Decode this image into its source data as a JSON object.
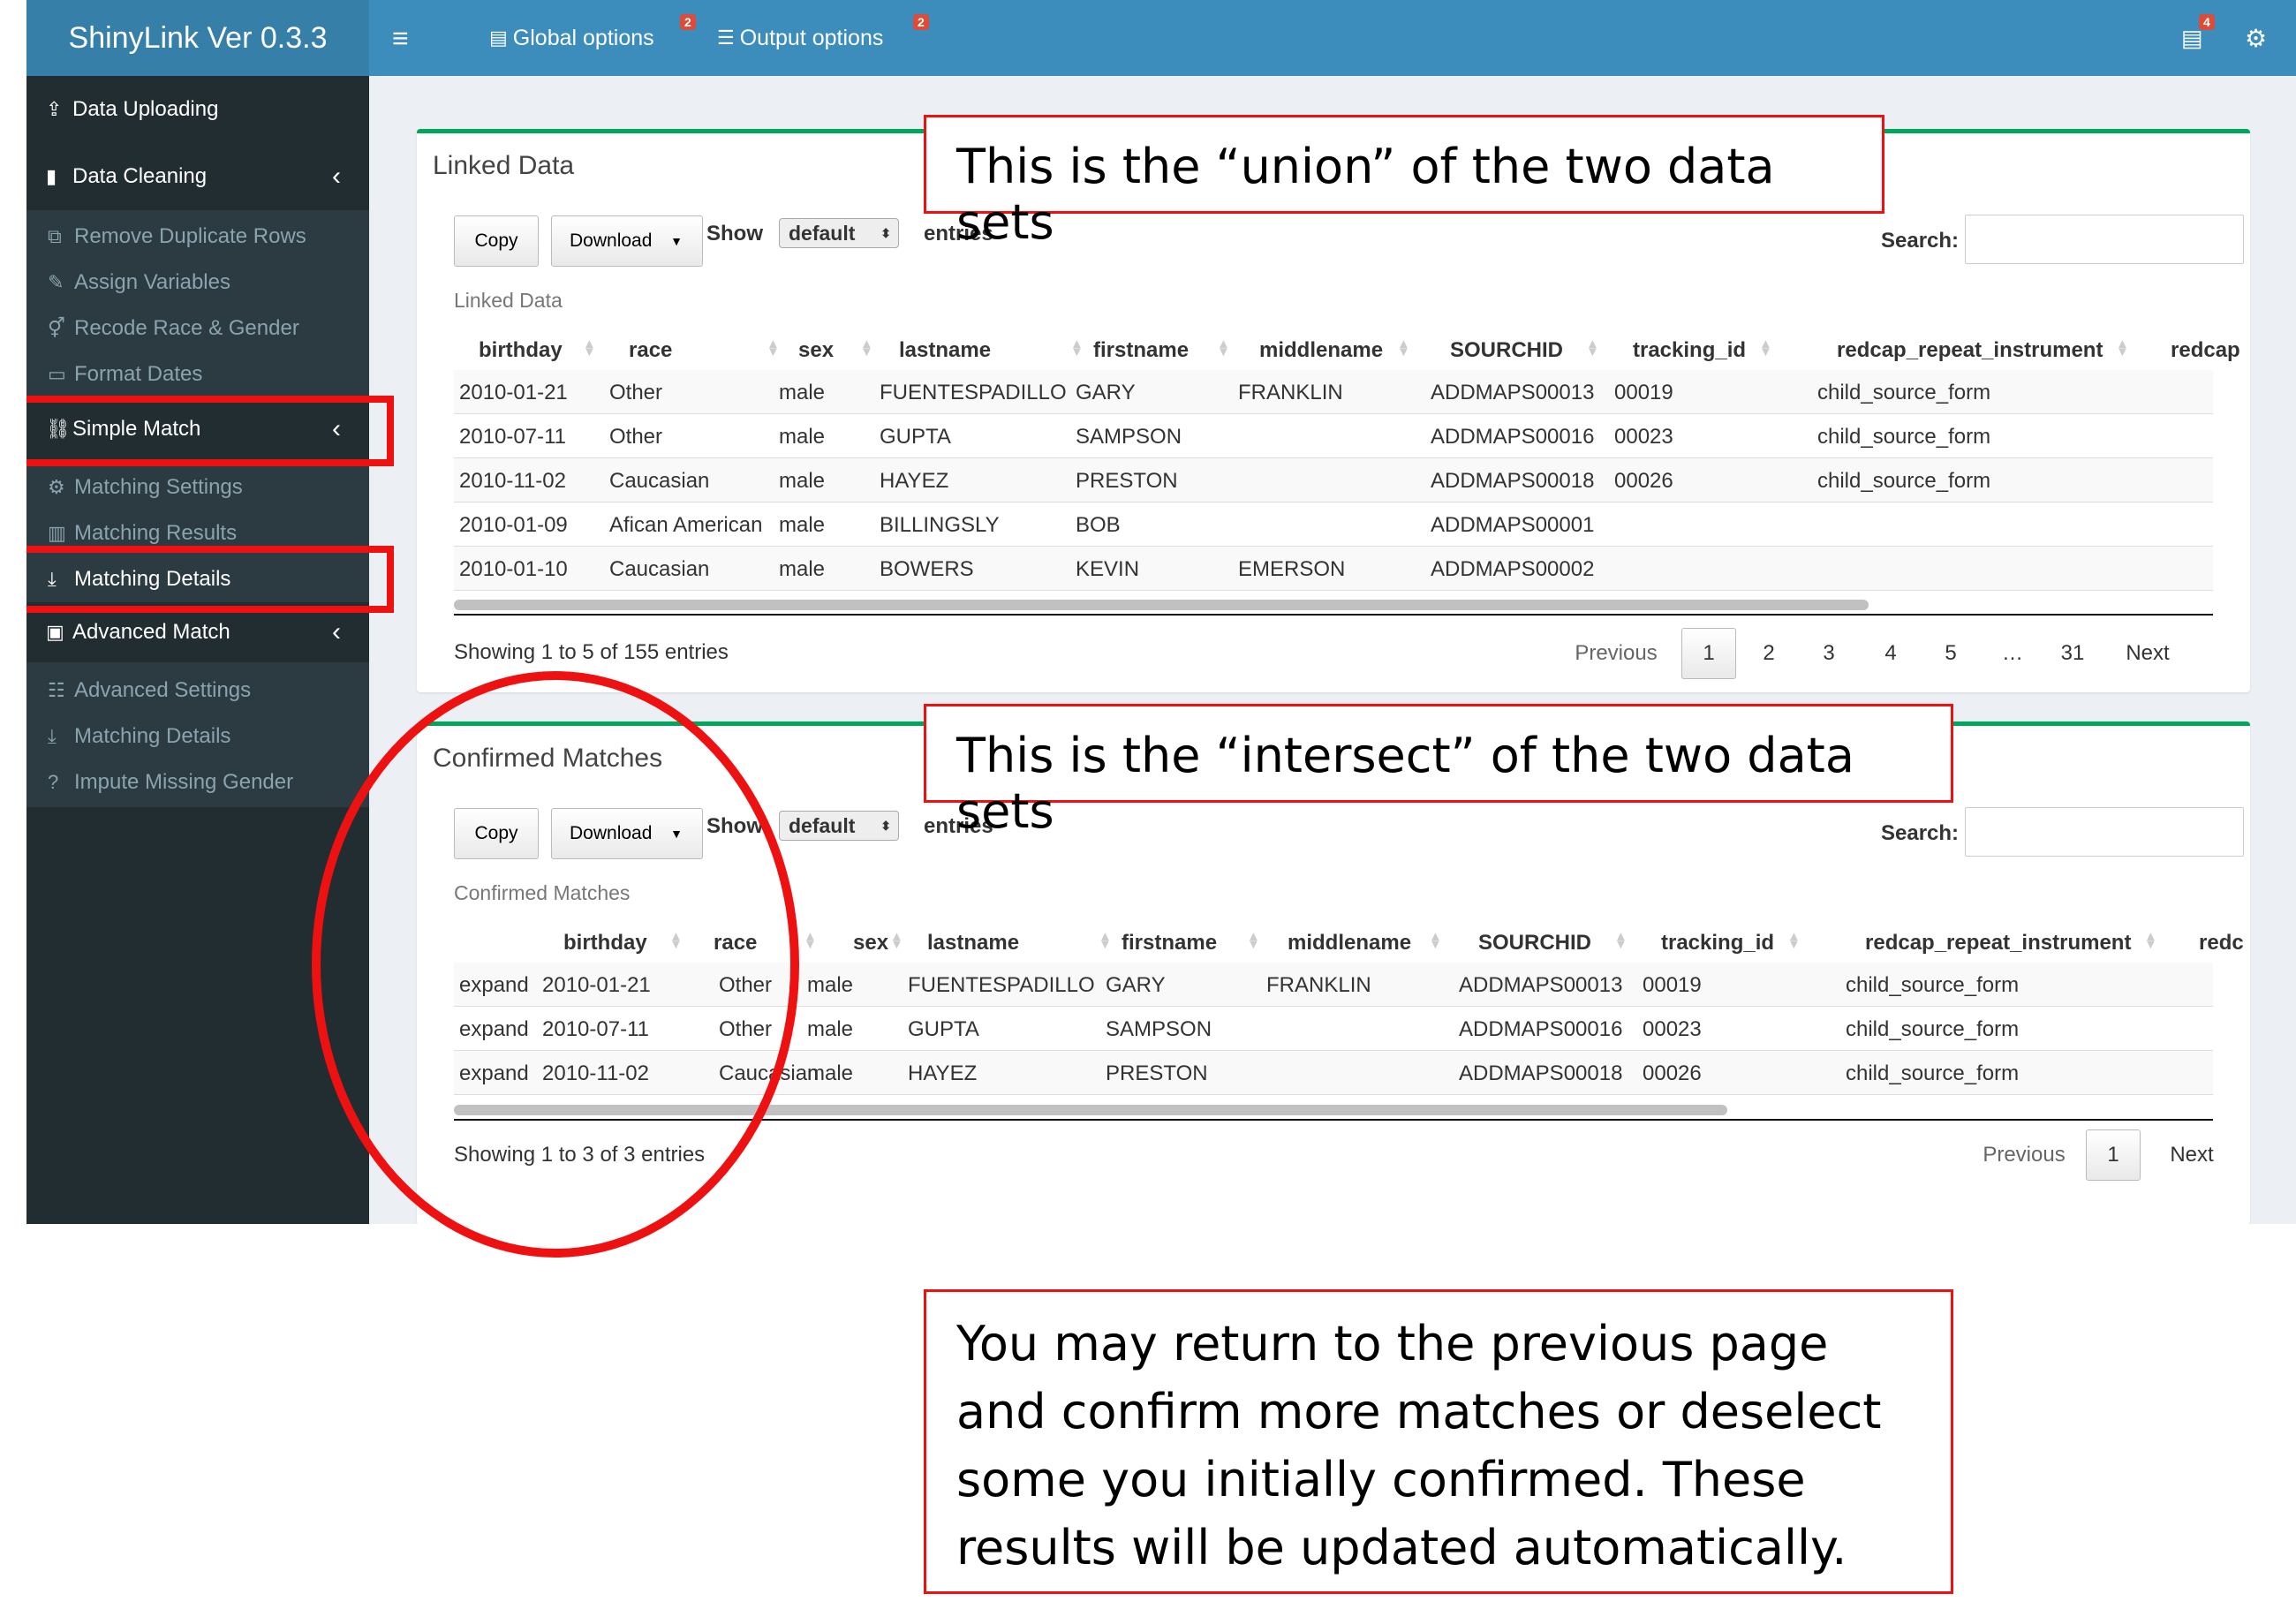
{
  "app": {
    "title": "ShinyLink Ver 0.3.3"
  },
  "topbar": {
    "menu_icon": "hamburger-icon",
    "global_options": "Global options",
    "global_badge": "2",
    "output_options": "Output options",
    "output_badge": "2",
    "tasks_badge": "4"
  },
  "sidebar": {
    "data_uploading": "Data Uploading",
    "data_cleaning": "Data Cleaning",
    "remove_duplicate": "Remove Duplicate Rows",
    "assign_variables": "Assign Variables",
    "recode": "Recode Race & Gender",
    "format_dates": "Format Dates",
    "simple_match": "Simple Match",
    "matching_settings": "Matching Settings",
    "matching_results": "Matching Results",
    "matching_details": "Matching Details",
    "advanced_match": "Advanced Match",
    "advanced_settings": "Advanced Settings",
    "adv_matching_details": "Matching Details",
    "impute": "Impute Missing Gender"
  },
  "linked": {
    "title": "Linked Data",
    "copy": "Copy",
    "download": "Download",
    "show": "Show",
    "select": "default",
    "entries": "entries",
    "search_label": "Search:",
    "caption": "Linked Data",
    "columns": [
      "birthday",
      "race",
      "sex",
      "lastname",
      "firstname",
      "middlename",
      "SOURCHID",
      "tracking_id",
      "redcap_repeat_instrument",
      "redcap"
    ],
    "rows": [
      [
        "2010-01-21",
        "Other",
        "male",
        "FUENTESPADILLO",
        "GARY",
        "FRANKLIN",
        "ADDMAPS00013",
        "00019",
        "child_source_form"
      ],
      [
        "2010-07-11",
        "Other",
        "male",
        "GUPTA",
        "SAMPSON",
        "",
        "ADDMAPS00016",
        "00023",
        "child_source_form"
      ],
      [
        "2010-11-02",
        "Caucasian",
        "male",
        "HAYEZ",
        "PRESTON",
        "",
        "ADDMAPS00018",
        "00026",
        "child_source_form"
      ],
      [
        "2010-01-09",
        "Afican American",
        "male",
        "BILLINGSLY",
        "BOB",
        "",
        "ADDMAPS00001",
        "",
        ""
      ],
      [
        "2010-01-10",
        "Caucasian",
        "male",
        "BOWERS",
        "KEVIN",
        "EMERSON",
        "ADDMAPS00002",
        "",
        ""
      ]
    ],
    "info": "Showing 1 to 5 of 155 entries",
    "pages": [
      "Previous",
      "1",
      "2",
      "3",
      "4",
      "5",
      "…",
      "31",
      "Next"
    ]
  },
  "confirmed": {
    "title": "Confirmed Matches",
    "copy": "Copy",
    "download": "Download",
    "show": "Show",
    "select": "default",
    "entries": "entries",
    "search_label": "Search:",
    "caption": "Confirmed Matches",
    "columns": [
      "birthday",
      "race",
      "sex",
      "lastname",
      "firstname",
      "middlename",
      "SOURCHID",
      "tracking_id",
      "redcap_repeat_instrument",
      "redc"
    ],
    "rows": [
      [
        "expand",
        "2010-01-21",
        "Other",
        "male",
        "FUENTESPADILLO",
        "GARY",
        "FRANKLIN",
        "ADDMAPS00013",
        "00019",
        "child_source_form"
      ],
      [
        "expand",
        "2010-07-11",
        "Other",
        "male",
        "GUPTA",
        "SAMPSON",
        "",
        "ADDMAPS00016",
        "00023",
        "child_source_form"
      ],
      [
        "expand",
        "2010-11-02",
        "Caucasian",
        "male",
        "HAYEZ",
        "PRESTON",
        "",
        "ADDMAPS00018",
        "00026",
        "child_source_form"
      ]
    ],
    "info": "Showing 1 to 3 of 3 entries",
    "pages": [
      "Previous",
      "1",
      "Next"
    ]
  },
  "callouts": {
    "union": "This is the “union” of the two data sets",
    "intersect": "This is the “intersect” of the two data sets",
    "note": "You may return to the previous page and confirm more matches or deselect some you initially confirmed. These results will be updated automatically."
  }
}
